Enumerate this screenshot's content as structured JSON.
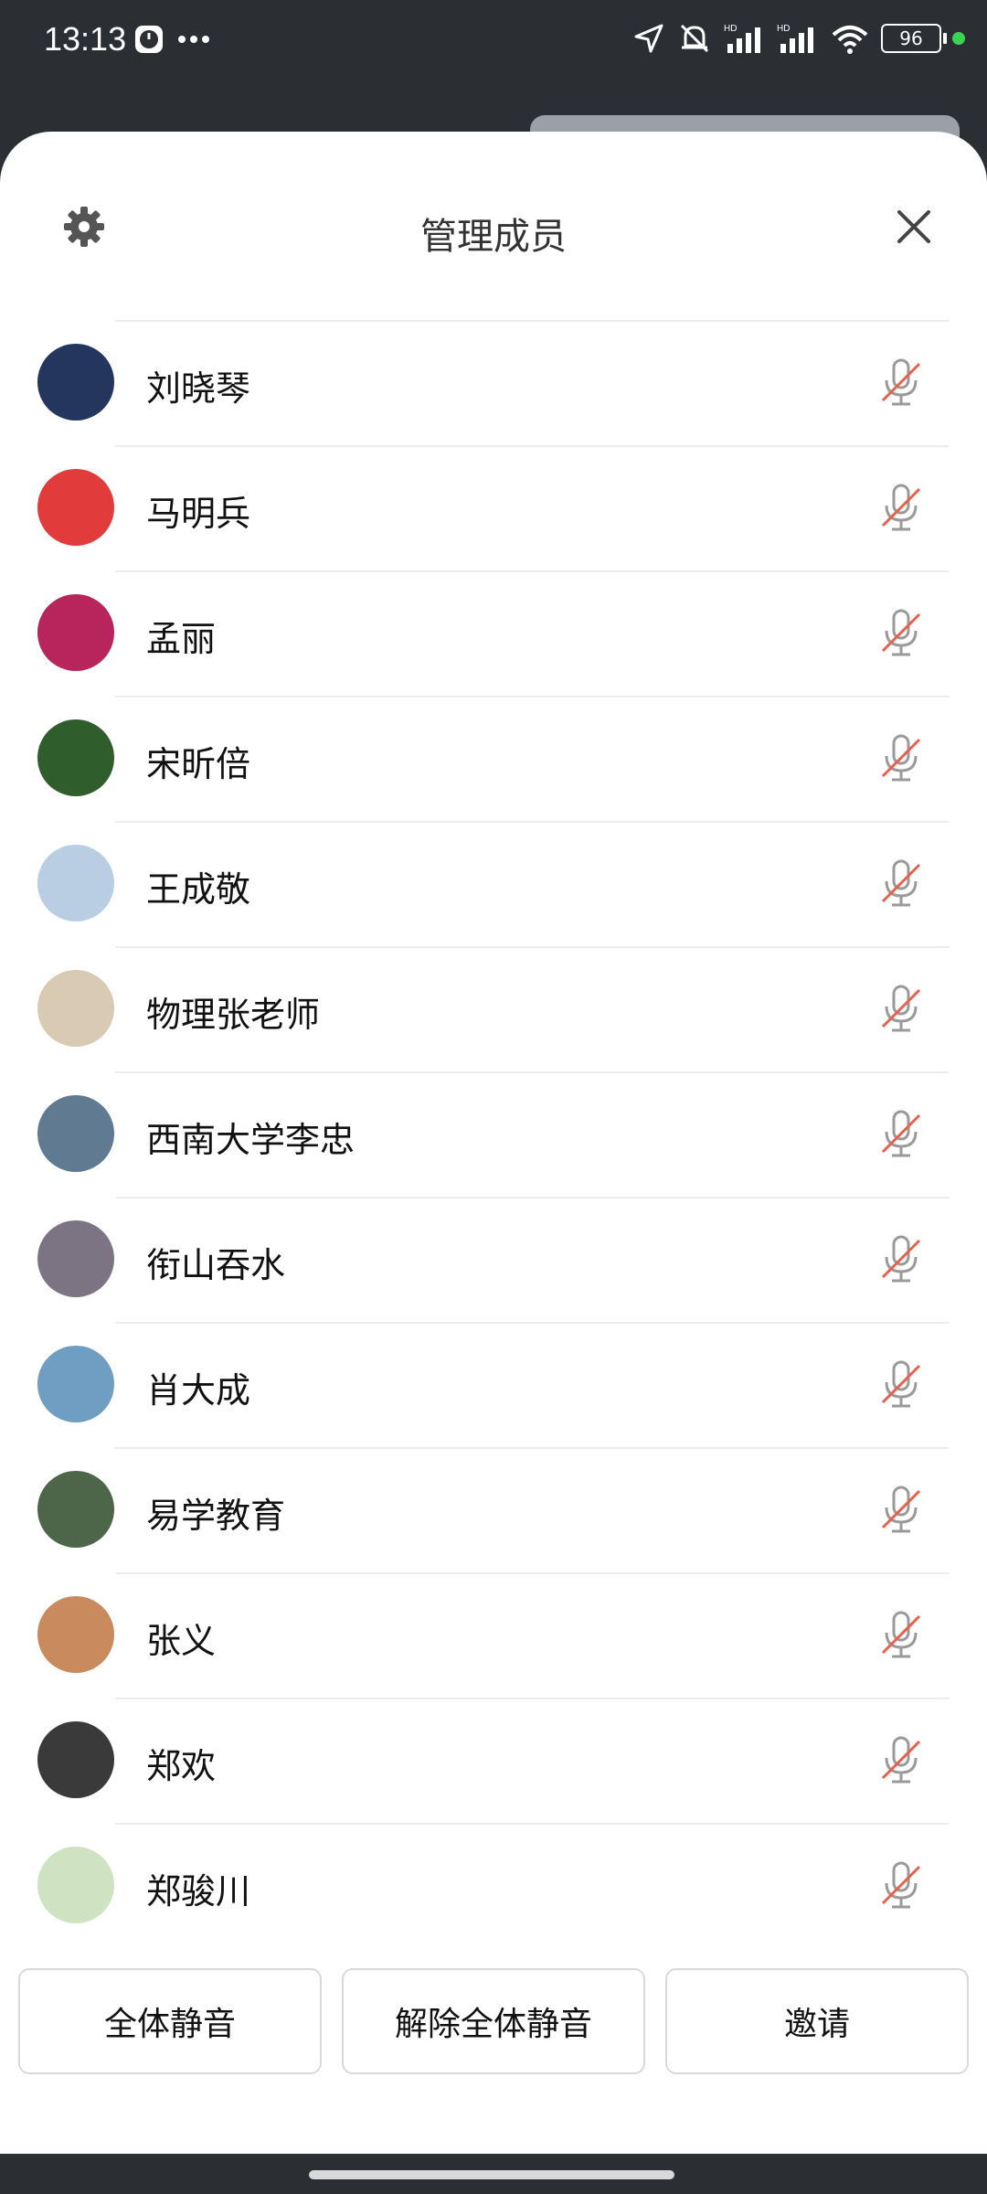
{
  "status_bar": {
    "time": "13:13",
    "battery": "96",
    "icons": [
      "clock-app-icon",
      "more-icon",
      "location-icon",
      "mute-icon",
      "signal-hd-icon",
      "signal-hd-icon",
      "wifi-icon",
      "battery-icon"
    ]
  },
  "sheet": {
    "title": "管理成员",
    "settings_icon": "gear-icon",
    "close_icon": "close-icon"
  },
  "members": [
    {
      "name": "刘晓琴",
      "avatar_color": "#24365e"
    },
    {
      "name": "马明兵",
      "avatar_color": "#e23b3b"
    },
    {
      "name": "孟丽",
      "avatar_color": "#b8245c"
    },
    {
      "name": "宋昕倍",
      "avatar_color": "#2f5d2c"
    },
    {
      "name": "王成敬",
      "avatar_color": "#b9cde3"
    },
    {
      "name": "物理张老师",
      "avatar_color": "#d9cbb3"
    },
    {
      "name": "西南大学李忠",
      "avatar_color": "#5f7a91"
    },
    {
      "name": "衔山吞水",
      "avatar_color": "#7c7482"
    },
    {
      "name": "肖大成",
      "avatar_color": "#6f9ec2"
    },
    {
      "name": "易学教育",
      "avatar_color": "#4d6548"
    },
    {
      "name": "张义",
      "avatar_color": "#c98a5e"
    },
    {
      "name": "郑欢",
      "avatar_color": "#3a3a3a"
    },
    {
      "name": "郑骏川",
      "avatar_color": "#cfe3c2"
    }
  ],
  "buttons": {
    "mute_all": "全体静音",
    "unmute_all": "解除全体静音",
    "invite": "邀请"
  }
}
